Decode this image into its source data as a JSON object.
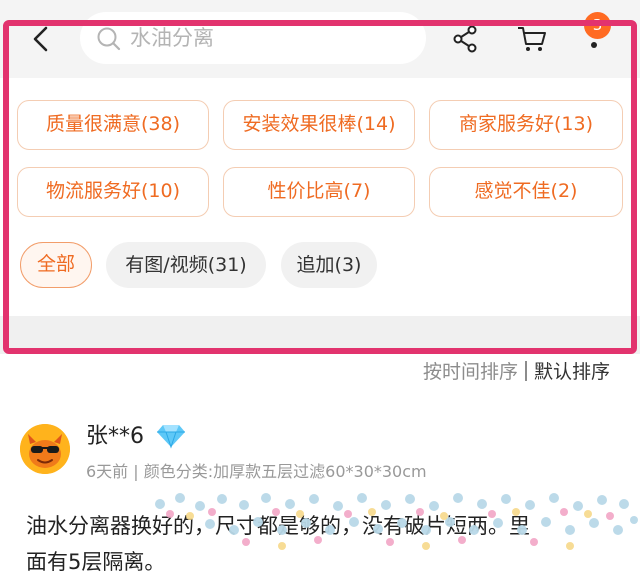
{
  "search": {
    "placeholder": "水油分离"
  },
  "header": {
    "cart_badge": "3"
  },
  "icons": {
    "back": "back-chevron-icon",
    "search": "search-icon",
    "share": "share-icon",
    "cart": "cart-icon",
    "more": "more-dots-icon",
    "diamond": "diamond-icon"
  },
  "review_tags": [
    {
      "label": "质量很满意(38)"
    },
    {
      "label": "安装效果很棒(14)"
    },
    {
      "label": "商家服务好(13)"
    },
    {
      "label": "物流服务好(10)"
    },
    {
      "label": "性价比高(7)"
    },
    {
      "label": "感觉不佳(2)"
    }
  ],
  "filters": [
    {
      "label": "全部",
      "active": true
    },
    {
      "label": "有图/视频(31)",
      "active": false
    },
    {
      "label": "追加(3)",
      "active": false
    }
  ],
  "sort": {
    "by_time": "按时间排序",
    "default": "默认排序"
  },
  "review": {
    "username": "张**6",
    "time": "6天前",
    "spec": "颜色分类:加厚款五层过滤60*30*30cm",
    "text_line1": "油水分离器换好的，尺寸都是够的，没有破片短两。里",
    "text_line2": "面有5层隔离。"
  },
  "colors": {
    "accent": "#ef6b22",
    "tag_border": "#f4cdb3",
    "highlight_frame": "#e2336e",
    "badge": "#ff6a22"
  }
}
